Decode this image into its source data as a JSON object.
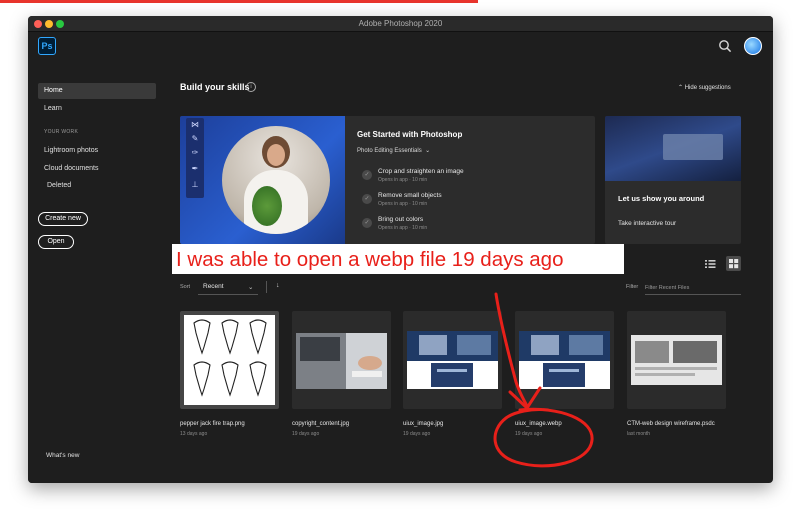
{
  "window": {
    "title": "Adobe Photoshop 2020",
    "app_logo": "Ps"
  },
  "sidebar": {
    "home": "Home",
    "learn": "Learn",
    "section_label": "YOUR WORK",
    "items": [
      "Lightroom photos",
      "Cloud documents",
      "Deleted"
    ],
    "create_new": "Create new",
    "open": "Open",
    "whats_new": "What's new"
  },
  "skills": {
    "heading": "Build your skills",
    "hide_label": "Hide suggestions",
    "main_card": {
      "title": "Get Started with Photoshop",
      "dropdown": "Photo Editing Essentials",
      "tutorials": [
        {
          "title": "Crop and straighten an image",
          "meta": "Opens in app · 10 min"
        },
        {
          "title": "Remove small objects",
          "meta": "Opens in app · 10 min"
        },
        {
          "title": "Bring out colors",
          "meta": "Opens in app · 10 min"
        }
      ]
    },
    "side_card": {
      "title": "Let us show you around",
      "link": "Take interactive tour"
    }
  },
  "annotation": {
    "text": "I was able to open a webp file 19 days ago",
    "color": "#e8201a"
  },
  "recent": {
    "sort_label": "Sort",
    "sort_value": "Recent",
    "filter_label": "Filter",
    "filter_placeholder": "Filter Recent Files",
    "files": [
      {
        "name": "pepper jack fire trap.png",
        "date": "13 days ago"
      },
      {
        "name": "copyright_content.jpg",
        "date": "19 days ago"
      },
      {
        "name": "uiux_image.jpg",
        "date": "19 days ago"
      },
      {
        "name": "uiux_image.webp",
        "date": "19 days ago"
      },
      {
        "name": "CTM-web design wireframe.psdc",
        "date": "last month"
      }
    ]
  },
  "colors": {
    "accent": "#31a8ff",
    "background": "#1e1e1e",
    "card": "#2c2c2c",
    "annotation": "#e8201a"
  }
}
